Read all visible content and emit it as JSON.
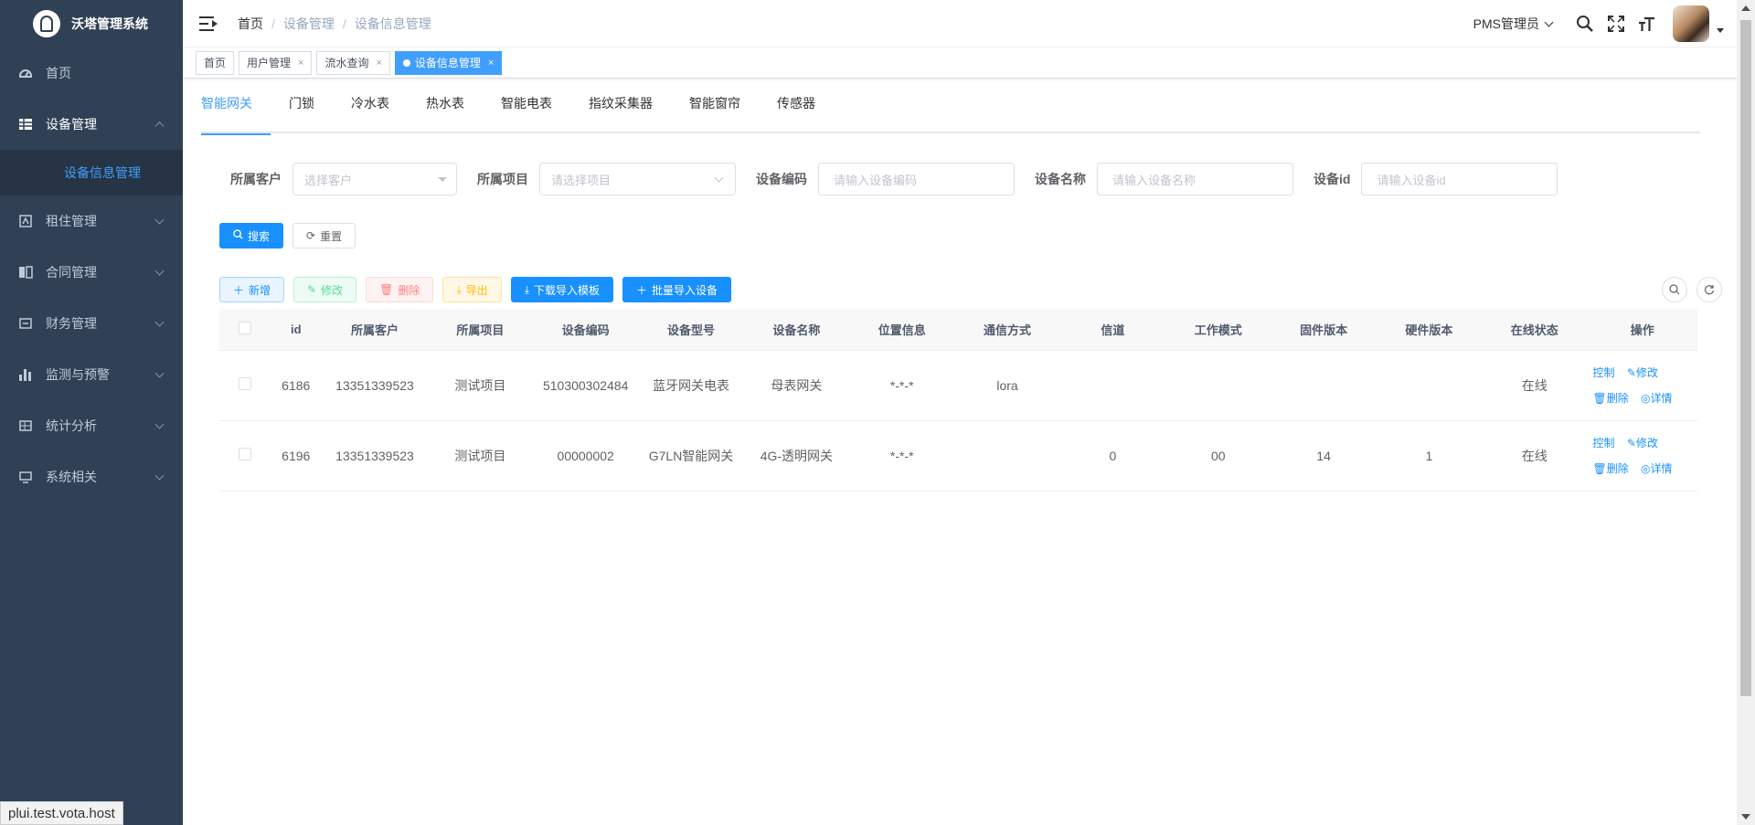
{
  "app": {
    "title": "沃塔管理系统"
  },
  "sidebar": {
    "items": [
      {
        "label": "首页",
        "icon": "dashboard-icon"
      },
      {
        "label": "设备管理",
        "icon": "table-grid-icon",
        "expanded": true,
        "children": [
          {
            "label": "设备信息管理",
            "active": true
          }
        ]
      },
      {
        "label": "租住管理",
        "icon": "rental-icon"
      },
      {
        "label": "合同管理",
        "icon": "book-icon"
      },
      {
        "label": "财务管理",
        "icon": "finance-icon"
      },
      {
        "label": "监测与预警",
        "icon": "bar-chart-icon"
      },
      {
        "label": "统计分析",
        "icon": "stats-icon"
      },
      {
        "label": "系统相关",
        "icon": "monitor-icon"
      }
    ]
  },
  "navbar": {
    "breadcrumb": [
      "首页",
      "设备管理",
      "设备信息管理"
    ],
    "user": "PMS管理员"
  },
  "tags": [
    {
      "label": "首页"
    },
    {
      "label": "用户管理",
      "closable": true
    },
    {
      "label": "流水查询",
      "closable": true
    },
    {
      "label": "设备信息管理",
      "closable": true,
      "active": true
    }
  ],
  "type_tabs": [
    "智能网关",
    "门锁",
    "冷水表",
    "热水表",
    "智能电表",
    "指纹采集器",
    "智能窗帘",
    "传感器"
  ],
  "filters": [
    {
      "label": "所属客户",
      "placeholder": "选择客户",
      "kind": "select-caret"
    },
    {
      "label": "所属项目",
      "placeholder": "请选择项目",
      "kind": "select-chevron"
    },
    {
      "label": "设备编码",
      "placeholder": "请输入设备编码",
      "kind": "input"
    },
    {
      "label": "设备名称",
      "placeholder": "请输入设备名称",
      "kind": "input"
    },
    {
      "label": "设备id",
      "placeholder": "请输入设备id",
      "kind": "input"
    }
  ],
  "buttons": {
    "search": "搜索",
    "reset": "重置",
    "add": "新增",
    "edit": "修改",
    "delete": "删除",
    "export": "导出",
    "download_template": "下载导入模板",
    "batch_import": "批量导入设备"
  },
  "table": {
    "columns": [
      "id",
      "所属客户",
      "所属项目",
      "设备编码",
      "设备型号",
      "设备名称",
      "位置信息",
      "通信方式",
      "信道",
      "工作模式",
      "固件版本",
      "硬件版本",
      "在线状态",
      "操作"
    ],
    "rows": [
      [
        "6186",
        "13351339523",
        "测试项目",
        "510300302484",
        "蓝牙网关电表",
        "母表网关",
        "*-*-*",
        "lora",
        "",
        "",
        "",
        "",
        "在线"
      ],
      [
        "6196",
        "13351339523",
        "测试项目",
        "00000002",
        "G7LN智能网关",
        "4G-透明网关",
        "*-*-*",
        "",
        "0",
        "00",
        "14",
        "1",
        "在线"
      ]
    ],
    "actions": [
      "控制",
      "修改",
      "删除",
      "详情"
    ]
  },
  "status_url": "plui.test.vota.host",
  "colors": {
    "sidebar_bg": "#304156",
    "primary": "#1890ff",
    "active_tab": "#409eff"
  }
}
